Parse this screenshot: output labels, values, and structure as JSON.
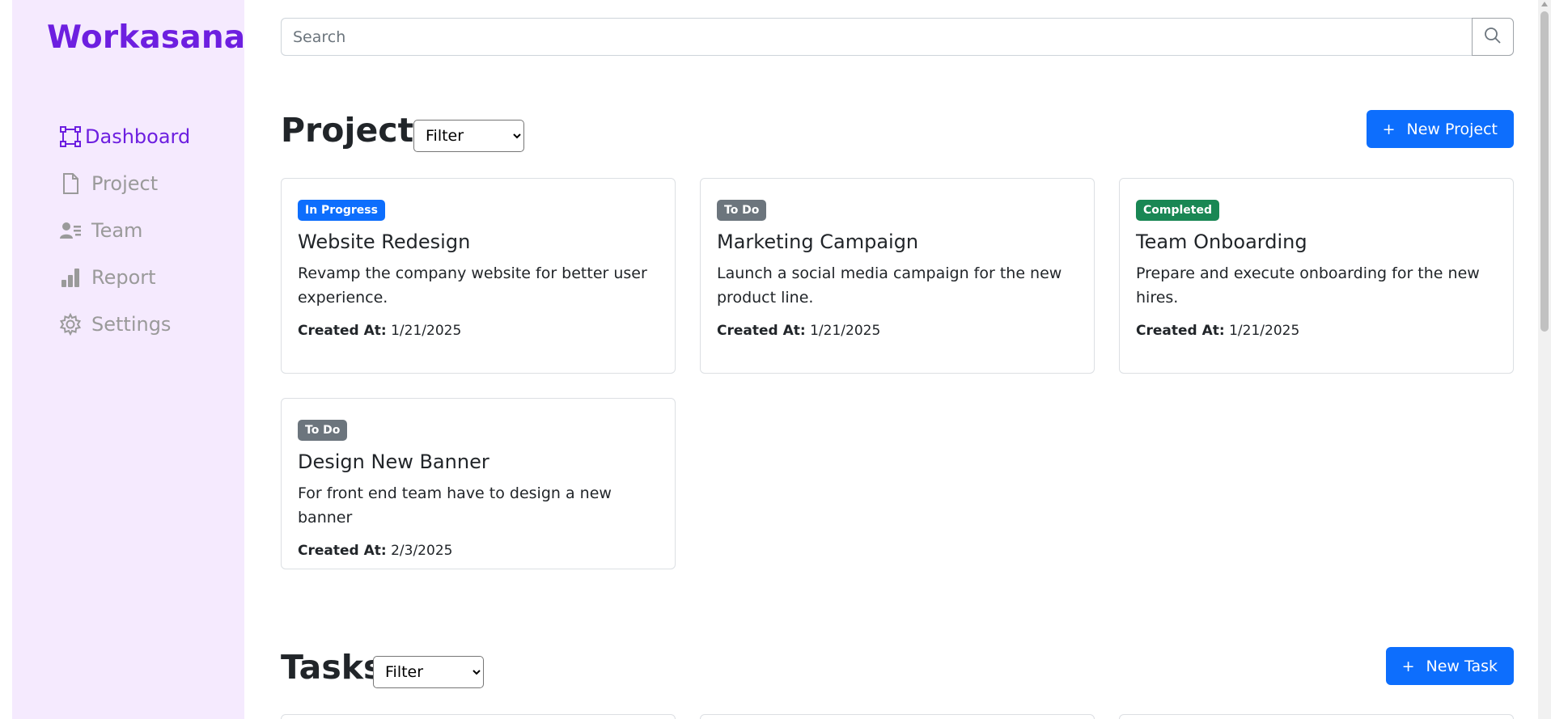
{
  "brand": "Workasana",
  "sidebar": {
    "items": [
      {
        "label": "Dashboard",
        "icon": "kanban-icon",
        "active": true
      },
      {
        "label": "Project",
        "icon": "file-icon",
        "active": false
      },
      {
        "label": "Team",
        "icon": "team-icon",
        "active": false
      },
      {
        "label": "Report",
        "icon": "bar-chart-icon",
        "active": false
      },
      {
        "label": "Settings",
        "icon": "gear-icon",
        "active": false
      }
    ]
  },
  "search": {
    "placeholder": "Search",
    "value": "",
    "icon": "search-icon"
  },
  "projects": {
    "title": "Projects",
    "filter_label": "Filter",
    "new_button": "New Project",
    "created_label": "Created At:",
    "cards": [
      {
        "status": "In Progress",
        "status_color": "#0d6efd",
        "title": "Website Redesign",
        "description": "Revamp the company website for better user experience.",
        "created": "1/21/2025"
      },
      {
        "status": "To Do",
        "status_color": "#6c757d",
        "title": "Marketing Campaign",
        "description": "Launch a social media campaign for the new product line.",
        "created": "1/21/2025"
      },
      {
        "status": "Completed",
        "status_color": "#198754",
        "title": "Team Onboarding",
        "description": "Prepare and execute onboarding for the new hires.",
        "created": "1/21/2025"
      },
      {
        "status": "To Do",
        "status_color": "#6c757d",
        "title": "Design New Banner",
        "description": "For front end team have to design a new banner",
        "created": "2/3/2025"
      }
    ]
  },
  "tasks": {
    "title": "Tasks",
    "filter_label": "Filter",
    "new_button": "New Task"
  },
  "colors": {
    "brand": "#6d1fe0",
    "sidebar_bg": "#f5eafe",
    "primary": "#0d6efd"
  }
}
